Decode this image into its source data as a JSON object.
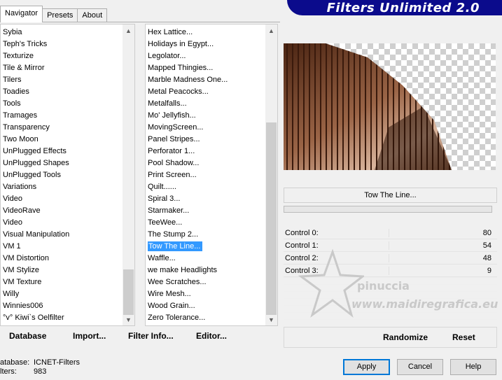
{
  "tabs": [
    "Navigator",
    "Presets",
    "About"
  ],
  "banner": "Filters Unlimited 2.0",
  "categories": [
    "Sybia",
    "Teph's Tricks",
    "Texturize",
    "Tile & Mirror",
    "Tilers",
    "Toadies",
    "Tools",
    "Tramages",
    "Transparency",
    "Two Moon",
    "UnPlugged Effects",
    "UnPlugged Shapes",
    "UnPlugged Tools",
    "Variations",
    "Video",
    "VideoRave",
    "Video",
    "Visual Manipulation",
    "VM 1",
    "VM Distortion",
    "VM Stylize",
    "VM Texture",
    "Willy",
    "Winnies006",
    "°v° Kiwi`s Oelfilter"
  ],
  "filters": [
    "Hex Lattice...",
    "Holidays in Egypt...",
    "Legolator...",
    "Mapped Thingies...",
    "Marble Madness One...",
    "Metal Peacocks...",
    "Metalfalls...",
    "Mo' Jellyfish...",
    "MovingScreen...",
    "Panel Stripes...",
    "Perforator 1...",
    "Pool Shadow...",
    "Print Screen...",
    "Quilt......",
    "Spiral 3...",
    "Starmaker...",
    "TeeWee...",
    "The Stump 2...",
    "Tow The Line...",
    "Waffle...",
    "we make Headlights",
    "Wee Scratches...",
    "Wire Mesh...",
    "Wood Grain...",
    "Zero Tolerance..."
  ],
  "selected_filter_index": 18,
  "selected_filter_name": "Tow The Line...",
  "controls": [
    {
      "label": "Control 0:",
      "value": "80"
    },
    {
      "label": "Control 1:",
      "value": "54"
    },
    {
      "label": "Control 2:",
      "value": "48"
    },
    {
      "label": "Control 3:",
      "value": "9"
    }
  ],
  "watermark": {
    "line1": "pinuccia",
    "line2": "www.maidiregrafica.eu"
  },
  "actions": {
    "database": "Database",
    "import": "Import...",
    "filter_info": "Filter Info...",
    "editor": "Editor...",
    "randomize": "Randomize",
    "reset": "Reset"
  },
  "footer": {
    "db_label": "atabase:",
    "db_value": "ICNET-Filters",
    "filters_label": "lters:",
    "filters_value": "983"
  },
  "buttons": {
    "apply": "Apply",
    "cancel": "Cancel",
    "help": "Help"
  },
  "colors": {
    "banner": "#0b0b8c",
    "selection": "#3399ff",
    "stripe_dark": "#3a1a0c",
    "stripe_mid": "#8a5535"
  }
}
